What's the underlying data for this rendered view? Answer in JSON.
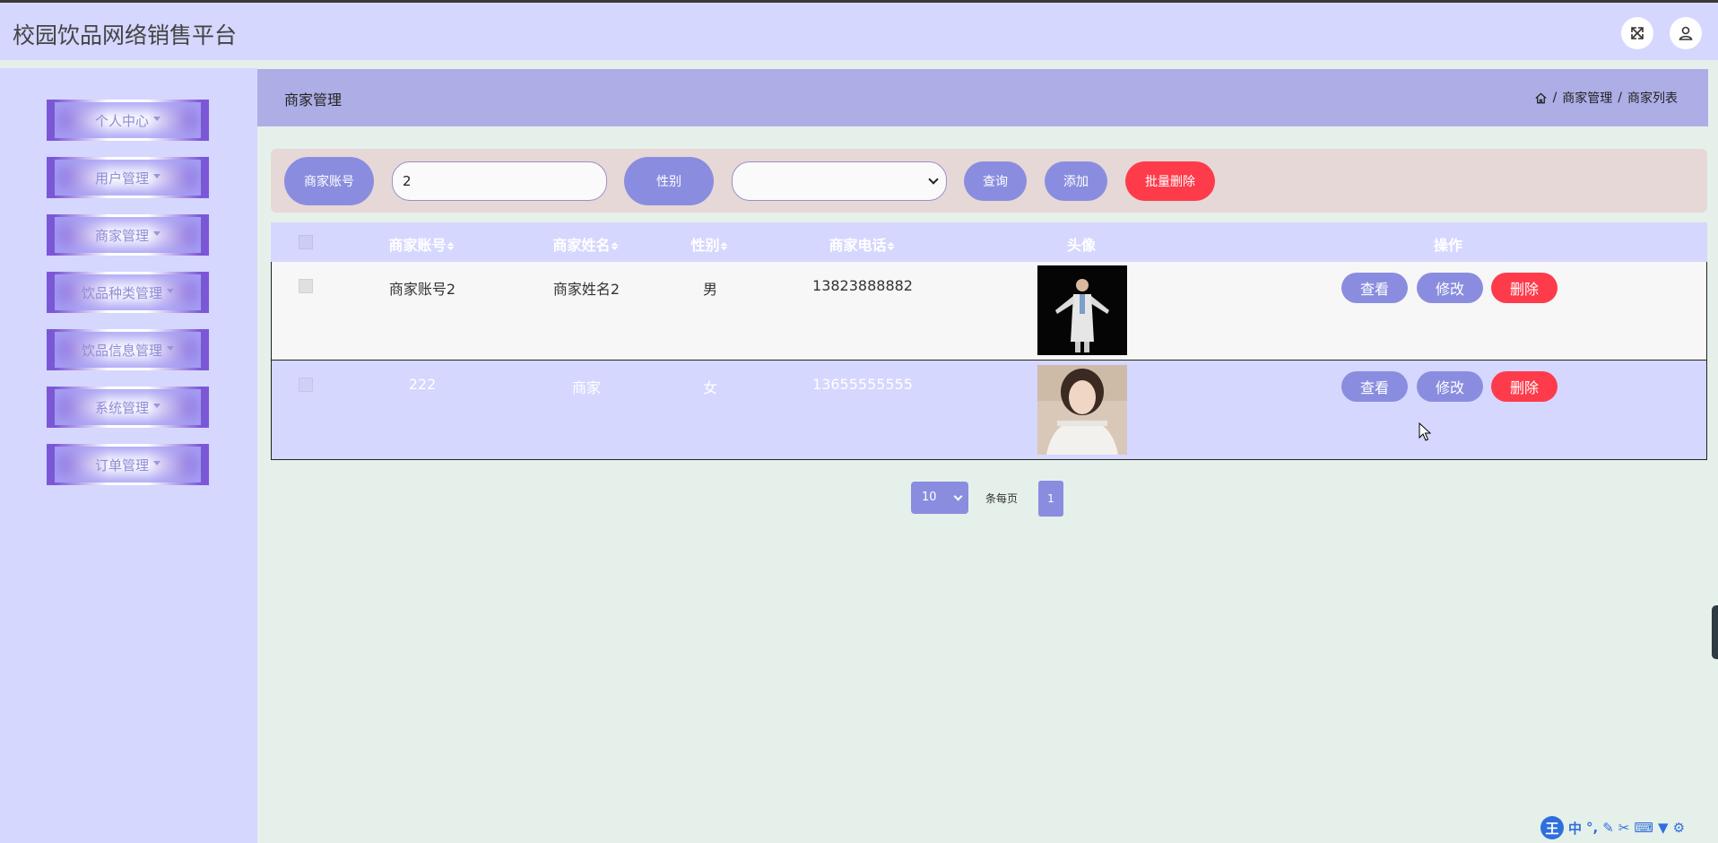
{
  "app": {
    "title": "校园饮品网络销售平台"
  },
  "header_icons": [
    "fullscreen-icon",
    "user-icon"
  ],
  "sidebar": {
    "items": [
      {
        "label": "个人中心"
      },
      {
        "label": "用户管理"
      },
      {
        "label": "商家管理"
      },
      {
        "label": "饮品种类管理"
      },
      {
        "label": "饮品信息管理"
      },
      {
        "label": "系统管理"
      },
      {
        "label": "订单管理"
      }
    ]
  },
  "page": {
    "title": "商家管理",
    "breadcrumb": {
      "item1": "商家管理",
      "item2": "商家列表"
    }
  },
  "search": {
    "account_label": "商家账号",
    "account_value": "2",
    "gender_label": "性别",
    "gender_value": "",
    "query_button": "查询",
    "add_button": "添加",
    "batch_delete_button": "批量删除"
  },
  "table": {
    "columns": {
      "account": "商家账号",
      "name": "商家姓名",
      "gender": "性别",
      "phone": "商家电话",
      "avatar": "头像",
      "actions": "操作"
    },
    "rows": [
      {
        "account": "商家账号2",
        "name": "商家姓名2",
        "gender": "男",
        "phone": "13823888882"
      },
      {
        "account": "222",
        "name": "商家",
        "gender": "女",
        "phone": "13655555555"
      }
    ],
    "actions": {
      "view": "查看",
      "edit": "修改",
      "delete": "删除"
    }
  },
  "pagination": {
    "page_size": "10",
    "per_page_label": "条每页",
    "current_page": "1"
  },
  "ime": {
    "logo": "王",
    "mode": "中"
  },
  "colors": {
    "accent": "#8a8ddf",
    "danger": "#fe3b4b",
    "topbar": "#d5d7fe",
    "header": "#adaee6"
  }
}
